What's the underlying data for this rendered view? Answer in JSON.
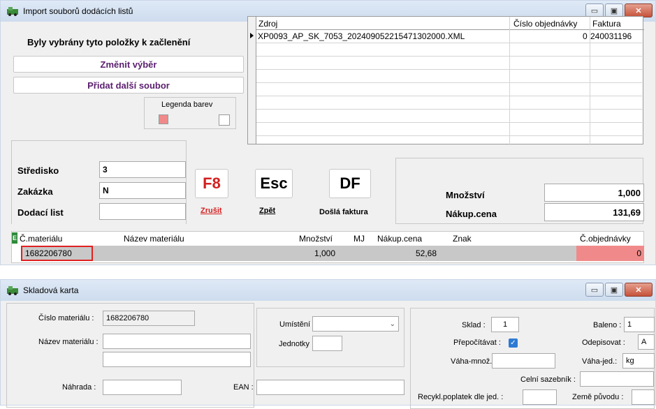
{
  "import_window": {
    "title": "Import souborů dodácích listů",
    "selected_label": "Byly vybrány tyto položky k začlenění",
    "change_selection_label": "Změnit výběr",
    "add_file_label": "Přidat další soubor",
    "legend_label": "Legenda barev",
    "legend_colors": [
      "#f08a8a",
      "#ffffff"
    ],
    "files_table": {
      "columns": [
        "Zdroj",
        "Číslo objednávky",
        "Faktura"
      ],
      "rows": [
        {
          "source": "XP0093_AP_SK_7053_20240905221547130200​0.XML",
          "order": "0",
          "invoice": "240031196"
        }
      ]
    },
    "fields": {
      "stredisko_label": "Středisko",
      "stredisko_value": "3",
      "zakazka_label": "Zakázka",
      "zakazka_value": "N",
      "dodaci_label": "Dodací list",
      "dodaci_value": ""
    },
    "keys": [
      {
        "key": "F8",
        "label": "Zrušit",
        "color": "#d42020"
      },
      {
        "key": "Esc",
        "label": "Zpět",
        "color": "#000000"
      },
      {
        "key": "DF",
        "label": "Došlá faktura",
        "color": "#000000"
      }
    ],
    "totals": {
      "quantity_label": "Množství",
      "quantity_value": "1,000",
      "price_label": "Nákup.cena",
      "price_value": "131,69"
    },
    "items_table": {
      "columns": [
        "Č.materiálu",
        "Název materiálu",
        "Množství",
        "MJ",
        "Nákup.cena",
        "Znak",
        "Č.objednávky"
      ],
      "rows": [
        {
          "material": "1682206780",
          "name": "",
          "qty": "1,000",
          "mj": "",
          "price": "52,68",
          "znak": "",
          "order": "0"
        }
      ]
    }
  },
  "card_window": {
    "title": "Skladová karta",
    "cislo_label": "Číslo materiálu :",
    "cislo_value": "1682206780",
    "nazev_label": "Název materiálu :",
    "nazev_value": "",
    "nahrada_label": "Náhrada :",
    "ean_label": "EAN :",
    "umisteni_label": "Umístění :",
    "jednotky_label": "Jednotky :",
    "sklad_label": "Sklad :",
    "sklad_value": "1",
    "prepocitavat_label": "Přepočítávat :",
    "vaha_mnoz_label": "Váha-množ.:",
    "celni_label": "Celní sazebník :",
    "recykl_label": "Recykl.poplatek dle jed. :",
    "baleno_label": "Baleno :",
    "baleno_value": "1",
    "odepisovat_label": "Odepisovat :",
    "odepisovat_value": "A",
    "vaha_jed_label": "Váha-jed.:",
    "vaha_jed_value": "kg",
    "zeme_label": "Země původu :"
  },
  "window_buttons": {
    "minimize": "▭",
    "maximize": "▣",
    "close": "✕"
  }
}
